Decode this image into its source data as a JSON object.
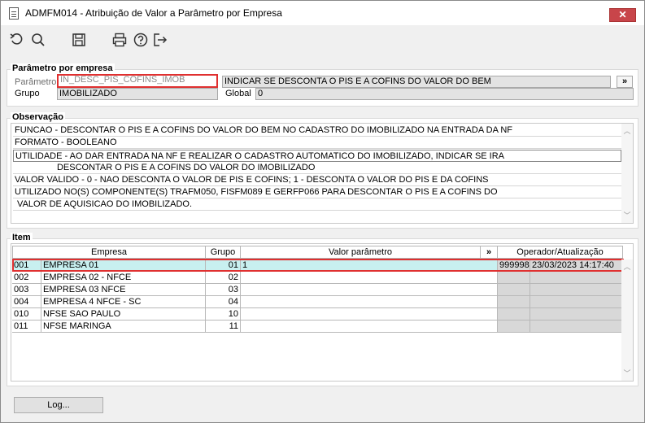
{
  "window": {
    "title": "ADMFM014 - Atribuição de Valor a Parâmetro por Empresa",
    "close_label": "✕"
  },
  "toolbar": {
    "icons": [
      "undo-icon",
      "search-icon",
      "save-icon",
      "print-icon",
      "help-icon",
      "exit-icon"
    ]
  },
  "parametro": {
    "group_title": "Parâmetro por empresa",
    "parametro_label": "Parâmetro",
    "parametro_value": "IN_DESC_PIS_COFINS_IMOB",
    "parametro_desc": "INDICAR SE DESCONTA O PIS E A COFINS DO VALOR DO BEM",
    "more_label": "»",
    "grupo_label": "Grupo",
    "grupo_value": "IMOBILIZADO",
    "global_label": "Global",
    "global_value": "0"
  },
  "observacao": {
    "group_title": "Observação",
    "lines": [
      "FUNCAO - DESCONTAR O PIS E A COFINS DO VALOR DO BEM NO CADASTRO DO IMOBILIZADO NA ENTRADA DA NF",
      "FORMATO - BOOLEANO",
      "UTILIDADE - AO DAR ENTRADA NA NF E REALIZAR O CADASTRO AUTOMATICO DO IMOBILIZADO, INDICAR SE IRA",
      "                 DESCONTAR O PIS E A COFINS DO VALOR DO IMOBILIZADO",
      "VALOR VALIDO - 0 - NAO DESCONTA O VALOR DE PIS E COFINS; 1 - DESCONTA O VALOR DO PIS E DA COFINS",
      "UTILIZADO NO(S) COMPONENTE(S) TRAFM050, FISFM089 E GERFP066  PARA  DESCONTAR O PIS E A COFINS DO",
      " VALOR DE AQUISICAO DO IMOBILIZADO."
    ]
  },
  "item": {
    "group_title": "Item",
    "headers": {
      "empresa": "Empresa",
      "grupo": "Grupo",
      "valor": "Valor parâmetro",
      "more": "»",
      "operador": "Operador/Atualização"
    },
    "rows": [
      {
        "cod": "001",
        "nome": "EMPRESA 01",
        "grupo": "01",
        "valor": "1",
        "operador": "999998",
        "data": "23/03/2023 14:17:40"
      },
      {
        "cod": "002",
        "nome": "EMPRESA 02 - NFCE",
        "grupo": "02",
        "valor": "",
        "operador": "",
        "data": ""
      },
      {
        "cod": "003",
        "nome": "EMPRESA 03 NFCE",
        "grupo": "03",
        "valor": "",
        "operador": "",
        "data": ""
      },
      {
        "cod": "004",
        "nome": "EMPRESA 4 NFCE - SC",
        "grupo": "04",
        "valor": "",
        "operador": "",
        "data": ""
      },
      {
        "cod": "010",
        "nome": "NFSE SAO PAULO",
        "grupo": "10",
        "valor": "",
        "operador": "",
        "data": ""
      },
      {
        "cod": "011",
        "nome": "NFSE MARINGA",
        "grupo": "11",
        "valor": "",
        "operador": "",
        "data": ""
      }
    ]
  },
  "footer": {
    "log_label": "Log..."
  }
}
